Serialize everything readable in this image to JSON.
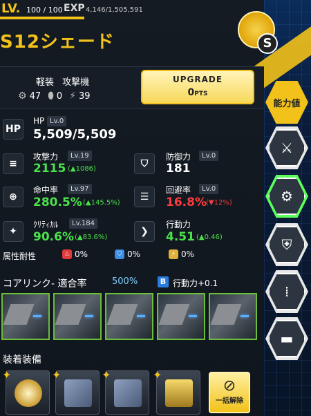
{
  "header": {
    "lv_label": "LV.",
    "lv_value": "100 / 100",
    "exp_label": "EXP",
    "exp_value": "4,146/1,505,591",
    "unit_name": "S12シェード",
    "rank_badge": "S"
  },
  "class_info": {
    "tags": [
      "軽装",
      "攻撃機"
    ],
    "counts": [
      {
        "icon": "gear-icon",
        "value": "47"
      },
      {
        "icon": "capsule-icon",
        "value": "0"
      },
      {
        "icon": "lightning-icon",
        "value": "39"
      }
    ],
    "upgrade_label": "UPGRADE",
    "upgrade_pts": "0",
    "upgrade_unit": "PTS"
  },
  "stats": {
    "hp": {
      "icon": "HP",
      "name": "HP",
      "lv": "Lv.0",
      "value": "5,509/5,509"
    },
    "attack": {
      "name": "攻撃力",
      "lv": "Lv.19",
      "value": "2115",
      "delta": "(▲1086)"
    },
    "defense": {
      "name": "防御力",
      "lv": "Lv.0",
      "value": "181"
    },
    "accuracy": {
      "name": "命中率",
      "lv": "Lv.97",
      "value": "280.5%",
      "delta": "(▲145.5%)"
    },
    "evasion": {
      "name": "回避率",
      "lv": "Lv.0",
      "value": "16.8%",
      "delta": "(▼12%)"
    },
    "critical": {
      "name": "ｸﾘﾃｨｶﾙ",
      "lv": "Lv.184",
      "value": "90.6%",
      "delta": "(▲83.6%)"
    },
    "action": {
      "name": "行動力",
      "value": "4.51",
      "delta": "(▲0.46)"
    }
  },
  "resist": {
    "label": "属性耐性",
    "items": [
      {
        "icon": "fire-icon",
        "value": "0%",
        "color": "#e03a3a"
      },
      {
        "icon": "ice-icon",
        "value": "0%",
        "color": "#3a8de0"
      },
      {
        "icon": "electric-icon",
        "value": "0%",
        "color": "#e0b23a"
      }
    ]
  },
  "core_link": {
    "label": "コアリンク-",
    "rate_label": "適合率",
    "rate_value": "500%",
    "bonus_icon": "B",
    "bonus_text": "行動力+0.1"
  },
  "equipment": {
    "label": "装着装備",
    "bulk_label": "一括解除"
  },
  "right_tabs": {
    "active_label": "能力値"
  },
  "colors": {
    "accent": "#f2c21a",
    "positive": "#4be34b",
    "negative": "#ff3b3b"
  }
}
